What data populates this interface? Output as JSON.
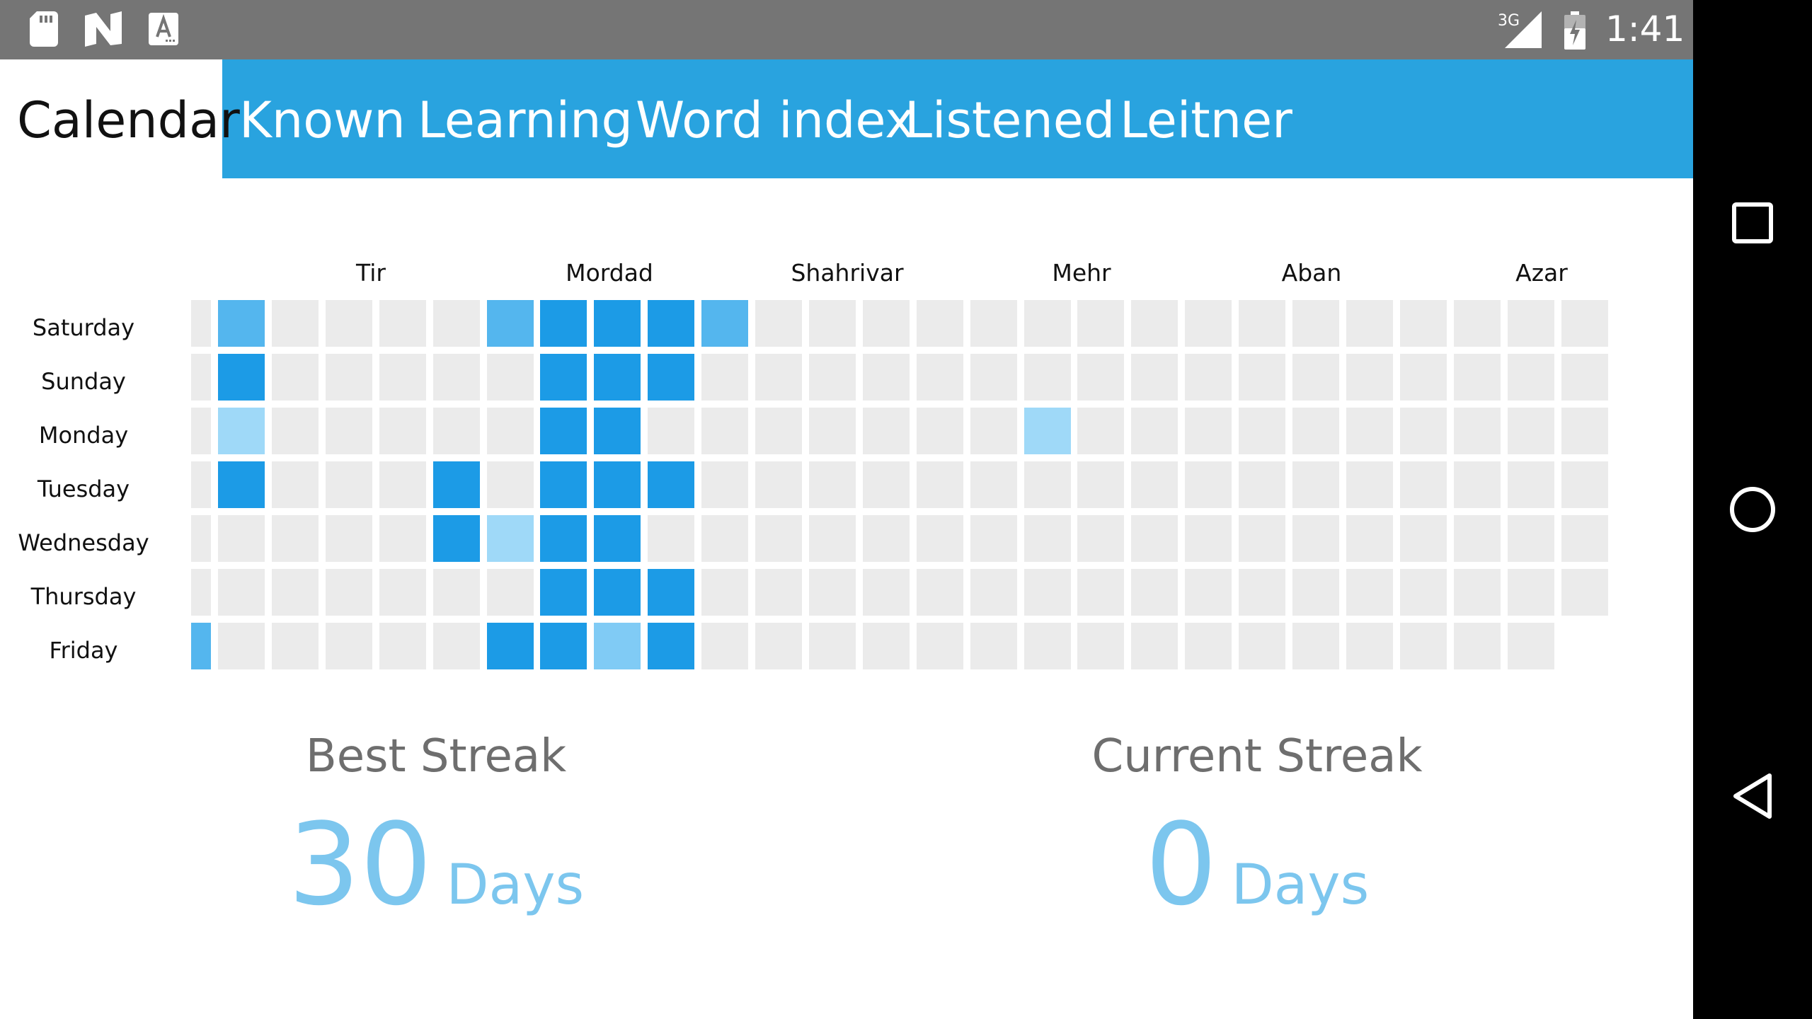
{
  "status_bar": {
    "icons": [
      "sd-card-icon",
      "n-logo-icon",
      "keyboard-a-icon"
    ],
    "network": "3G",
    "time": "1:41"
  },
  "tabs": [
    {
      "label": "Calendar",
      "active": true
    },
    {
      "label": "Known",
      "active": false
    },
    {
      "label": "Learning",
      "active": false
    },
    {
      "label": "Word index",
      "active": false
    },
    {
      "label": "Listened",
      "active": false
    },
    {
      "label": "Leitner",
      "active": false
    }
  ],
  "calendar": {
    "months": [
      "Tir",
      "Mordad",
      "Shahrivar",
      "Mehr",
      "Aban",
      "Azar"
    ],
    "days": [
      "Saturday",
      "Sunday",
      "Monday",
      "Tuesday",
      "Wednesday",
      "Thursday",
      "Friday"
    ],
    "colors": {
      "empty": "#ebebeb",
      "level1": "#9fd9f8",
      "level2": "#80cbf5",
      "level3": "#54b6ee",
      "level4": "#1c9be6"
    },
    "activity_levels": [
      [
        0,
        3,
        0,
        0,
        0,
        0,
        3,
        4,
        4,
        4,
        3,
        0,
        0,
        0,
        0,
        0,
        0,
        0,
        0,
        0,
        0,
        0,
        0,
        0,
        0,
        0,
        0
      ],
      [
        0,
        4,
        0,
        0,
        0,
        0,
        0,
        4,
        4,
        4,
        0,
        0,
        0,
        0,
        0,
        0,
        0,
        0,
        0,
        0,
        0,
        0,
        0,
        0,
        0,
        0,
        0
      ],
      [
        0,
        1,
        0,
        0,
        0,
        0,
        0,
        4,
        4,
        0,
        0,
        0,
        0,
        0,
        0,
        0,
        1,
        0,
        0,
        0,
        0,
        0,
        0,
        0,
        0,
        0,
        0
      ],
      [
        0,
        4,
        0,
        0,
        0,
        4,
        0,
        4,
        4,
        4,
        0,
        0,
        0,
        0,
        0,
        0,
        0,
        0,
        0,
        0,
        0,
        0,
        0,
        0,
        0,
        0,
        0
      ],
      [
        0,
        0,
        0,
        0,
        0,
        4,
        1,
        4,
        4,
        0,
        0,
        0,
        0,
        0,
        0,
        0,
        0,
        0,
        0,
        0,
        0,
        0,
        0,
        0,
        0,
        0,
        0
      ],
      [
        0,
        0,
        0,
        0,
        0,
        0,
        0,
        4,
        4,
        4,
        0,
        0,
        0,
        0,
        0,
        0,
        0,
        0,
        0,
        0,
        0,
        0,
        0,
        0,
        0,
        0,
        0
      ],
      [
        3,
        0,
        0,
        0,
        0,
        0,
        4,
        4,
        2,
        4,
        0,
        0,
        0,
        0,
        0,
        0,
        0,
        0,
        0,
        0,
        0,
        0,
        0,
        0,
        0,
        0,
        null
      ]
    ]
  },
  "best_streak": {
    "title": "Best Streak",
    "value": "30",
    "unit": "Days"
  },
  "current_streak": {
    "title": "Current Streak",
    "value": "0",
    "unit": "Days"
  },
  "nav": {
    "buttons": [
      "recent-apps",
      "home",
      "back"
    ]
  }
}
